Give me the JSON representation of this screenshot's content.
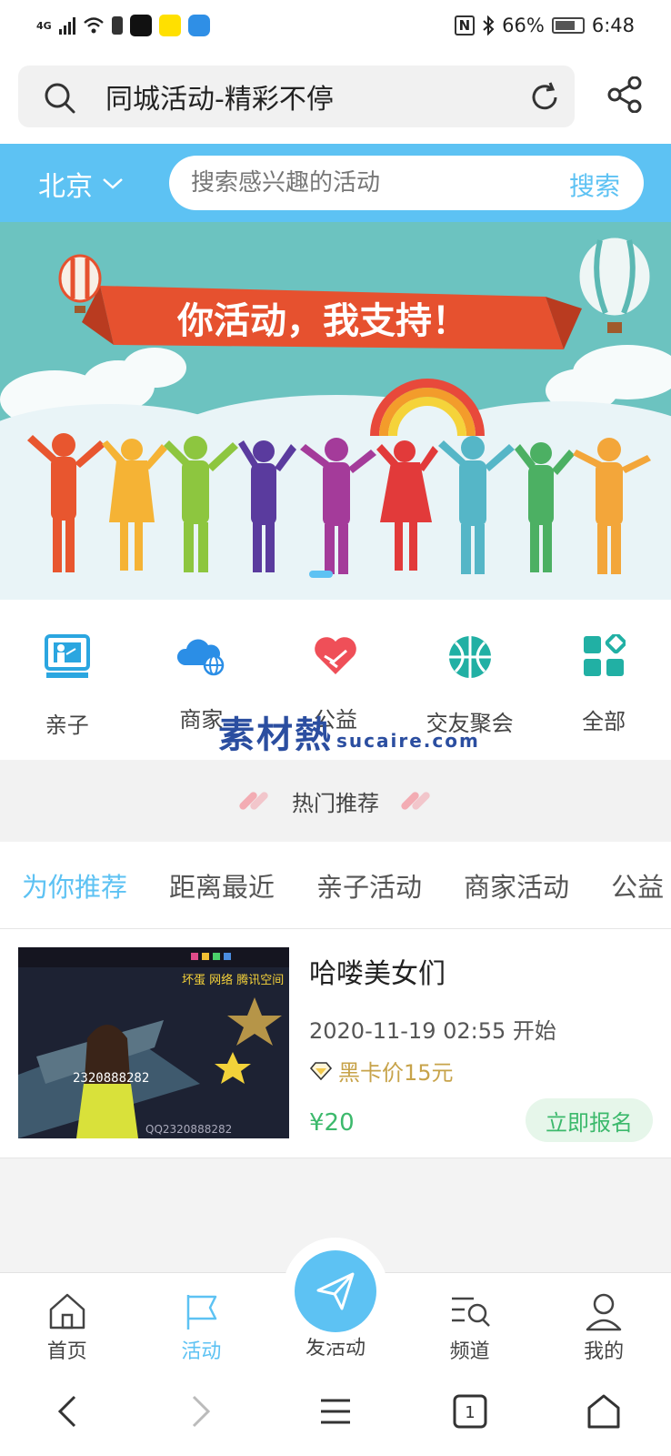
{
  "status_bar": {
    "network": "4G",
    "nfc": "N",
    "battery": "66%",
    "time": "6:48"
  },
  "browser": {
    "url_title": "同城活动-精彩不停"
  },
  "city_bar": {
    "city": "北京",
    "search_placeholder": "搜索感兴趣的活动",
    "search_button": "搜索"
  },
  "banner": {
    "slogan": "你活动，我支持！"
  },
  "categories": [
    {
      "label": "亲子",
      "icon": "parent-child-icon"
    },
    {
      "label": "商家",
      "icon": "merchant-cloud-icon"
    },
    {
      "label": "公益",
      "icon": "charity-heart-icon"
    },
    {
      "label": "交友聚会",
      "icon": "social-ball-icon"
    },
    {
      "label": "全部",
      "icon": "all-grid-icon"
    }
  ],
  "watermark": {
    "text": "素材熱",
    "domain": "sucaire.com"
  },
  "hot": {
    "title": "热门推荐"
  },
  "tabs": [
    {
      "label": "为你推荐",
      "active": true
    },
    {
      "label": "距离最近",
      "active": false
    },
    {
      "label": "亲子活动",
      "active": false
    },
    {
      "label": "商家活动",
      "active": false
    },
    {
      "label": "公益",
      "active": false
    }
  ],
  "activity": {
    "title": "哈喽美女们",
    "time": "2020-11-19 02:55 开始",
    "vip_price": "黑卡价15元",
    "price": "¥20",
    "signup": "立即报名",
    "thumb_text": {
      "header": "坏蛋 网络 腾讯空间",
      "number": "2320888282",
      "qq": "QQ2320888282"
    }
  },
  "bottom_nav": [
    {
      "label": "首页",
      "icon": "home-icon",
      "active": false
    },
    {
      "label": "活动",
      "icon": "flag-icon",
      "active": true
    },
    {
      "label": "发活动",
      "icon": "send-icon",
      "active": false
    },
    {
      "label": "频道",
      "icon": "channel-search-icon",
      "active": false
    },
    {
      "label": "我的",
      "icon": "user-icon",
      "active": false
    }
  ],
  "colors": {
    "accent": "#5dc2f3",
    "green": "#3cb96c",
    "gold": "#c7a34a"
  }
}
